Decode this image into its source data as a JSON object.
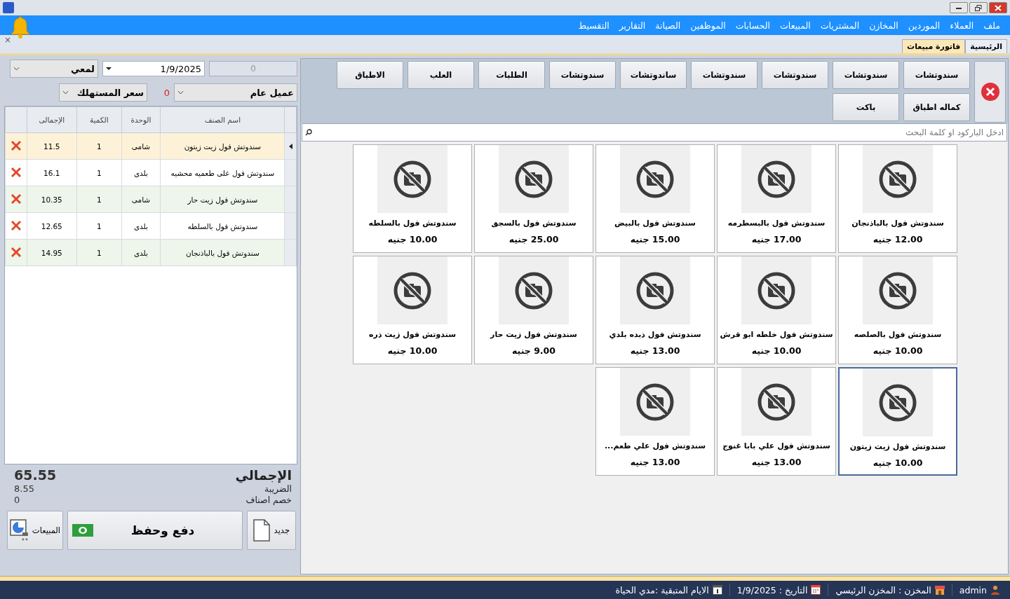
{
  "menu": [
    {
      "label": "ملف"
    },
    {
      "label": "العملاء"
    },
    {
      "label": "الموردين"
    },
    {
      "label": "المخازن"
    },
    {
      "label": "المشتريات"
    },
    {
      "label": "المبيعات"
    },
    {
      "label": "الحسابات"
    },
    {
      "label": "الموظفين"
    },
    {
      "label": "الصيانة"
    },
    {
      "label": "التقارير"
    },
    {
      "label": "التقسيط"
    }
  ],
  "tab_close": "×",
  "tabs": [
    {
      "label": "الرئيسية",
      "selected": false
    },
    {
      "label": "فاتورة مبيعات",
      "selected": true
    }
  ],
  "invoice": {
    "number": "0",
    "date": "1/9/2025",
    "user": "لمعي",
    "customer": "عميل عام",
    "balance": "0",
    "price_list": "سعر المستهلك",
    "columns": [
      "اسم الصنف",
      "الوحدة",
      "الكمية",
      "الإجمالى"
    ],
    "rows": [
      {
        "item": "سندوتش فول زيت زيتون",
        "unit": "شامى",
        "qty": "1",
        "total": "11.5",
        "selected": true
      },
      {
        "item": "سندوتش فول على طعميه محشيه",
        "unit": "بلدى",
        "qty": "1",
        "total": "16.1",
        "selected": false
      },
      {
        "item": "سندوتش فول زيت حار",
        "unit": "شامى",
        "qty": "1",
        "total": "10.35",
        "selected": false
      },
      {
        "item": "سندوتش فول بالسلطه",
        "unit": "بلدى",
        "qty": "1",
        "total": "12.65",
        "selected": false
      },
      {
        "item": "سندوتش فول بالباذنجان",
        "unit": "بلدى",
        "qty": "1",
        "total": "14.95",
        "selected": false
      }
    ]
  },
  "totals": {
    "total_label": "الإجمالي",
    "total": "65.55",
    "tax_label": "الضريبة",
    "tax": "8.55",
    "discount_label": "خصم اصناف",
    "discount": "0"
  },
  "actions": {
    "new": "جديد",
    "pay": "دفع وحفظ",
    "sales": "المبيعات"
  },
  "categories": [
    {
      "label": "سندوتشات"
    },
    {
      "label": "سندوتشات"
    },
    {
      "label": "سندوتشات"
    },
    {
      "label": "سندوتشات"
    },
    {
      "label": "ساندوتشات"
    },
    {
      "label": "سندوتشات"
    },
    {
      "label": "الطلبات"
    },
    {
      "label": "العلب"
    },
    {
      "label": "الاطباق"
    },
    {
      "label": "كماله اطباق"
    },
    {
      "label": "باكت"
    }
  ],
  "search": {
    "placeholder": "ادخل الباركود او كلمة البحث"
  },
  "products": [
    {
      "name": "سندوتش فول بالباذنجان",
      "price": "12.00 جنيه",
      "selected": false
    },
    {
      "name": "سندوتش فول بالبسطرمه",
      "price": "17.00 جنيه",
      "selected": false
    },
    {
      "name": "سندوتش فول بالبيض",
      "price": "15.00 جنيه",
      "selected": false
    },
    {
      "name": "سندوتش فول بالسجق",
      "price": "25.00 جنيه",
      "selected": false
    },
    {
      "name": "سندوتش فول بالسلطه",
      "price": "10.00 جنيه",
      "selected": false
    },
    {
      "name": "سندوتش فول بالصلصه",
      "price": "10.00 جنيه",
      "selected": false
    },
    {
      "name": "سندوتش فول خلطه ابو قرش",
      "price": "10.00 جنيه",
      "selected": false
    },
    {
      "name": "سندوتش فول ذبده بلدي",
      "price": "13.00 جنيه",
      "selected": false
    },
    {
      "name": "سندوتش فول زيت حار",
      "price": "9.00 جنيه",
      "selected": false
    },
    {
      "name": "سندوتش فول زيت ذره",
      "price": "10.00 جنيه",
      "selected": false
    },
    {
      "name": "سندوتش فول زيت زيتون",
      "price": "10.00 جنيه",
      "selected": true
    },
    {
      "name": "سندوتش فول علي بابا غنوج",
      "price": "13.00 جنيه",
      "selected": false
    },
    {
      "name": "سندوتش فول علي طعم...",
      "price": "13.00 جنيه",
      "selected": false
    }
  ],
  "status_bar": {
    "user": "admin",
    "store": "المخزن : المخزن الرئيسي",
    "date": "التاريخ : 1/9/2025",
    "days": "الايام المتبقية :مدي الحياة"
  }
}
